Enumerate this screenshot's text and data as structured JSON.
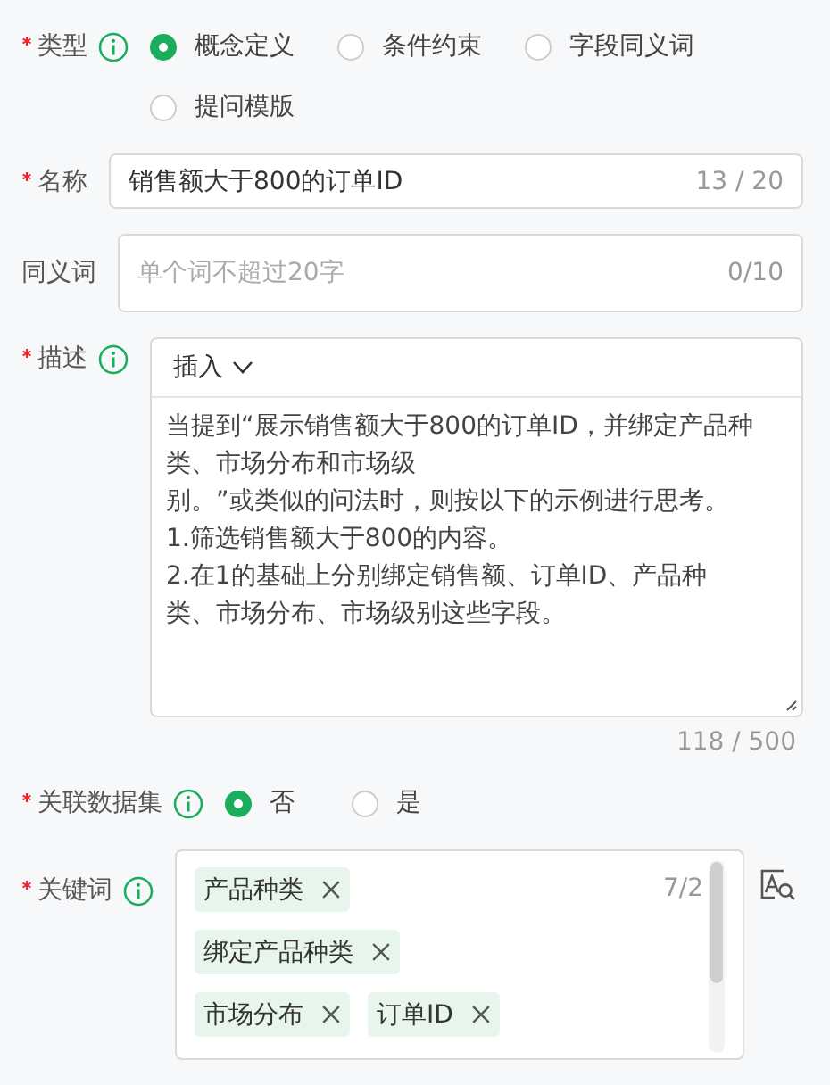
{
  "type_field": {
    "label": "类型",
    "required": true,
    "info": true,
    "options": [
      {
        "label": "概念定义",
        "selected": true
      },
      {
        "label": "条件约束",
        "selected": false
      },
      {
        "label": "字段同义词",
        "selected": false
      },
      {
        "label": "提问模版",
        "selected": false
      }
    ]
  },
  "name_field": {
    "label": "名称",
    "required": true,
    "value": "销售额大于800的订单ID",
    "counter": "13 / 20"
  },
  "synonym_field": {
    "label": "同义词",
    "required": false,
    "placeholder": "单个词不超过20字",
    "counter": "0/10"
  },
  "description_field": {
    "label": "描述",
    "required": true,
    "info": true,
    "insert_button": "插入",
    "lines": [
      "当提到“展示销售额大于800的订单ID，并绑定产品种类、市场分布和市场级",
      "别。”或类似的问法时，则按以下的示例进行思考。",
      "1.筛选销售额大于800的内容。",
      "2.在1的基础上分别绑定销售额、订单ID、产品种类、市场分布、市场级别这些字段。"
    ],
    "counter": "118 / 500"
  },
  "dataset_field": {
    "label": "关联数据集",
    "required": true,
    "info": true,
    "options": [
      {
        "label": "否",
        "selected": true
      },
      {
        "label": "是",
        "selected": false
      }
    ]
  },
  "keywords_field": {
    "label": "关键词",
    "required": true,
    "info": true,
    "counter": "7/2",
    "tags": [
      "产品种类",
      "绑定产品种类",
      "市场分布",
      "订单ID"
    ]
  }
}
